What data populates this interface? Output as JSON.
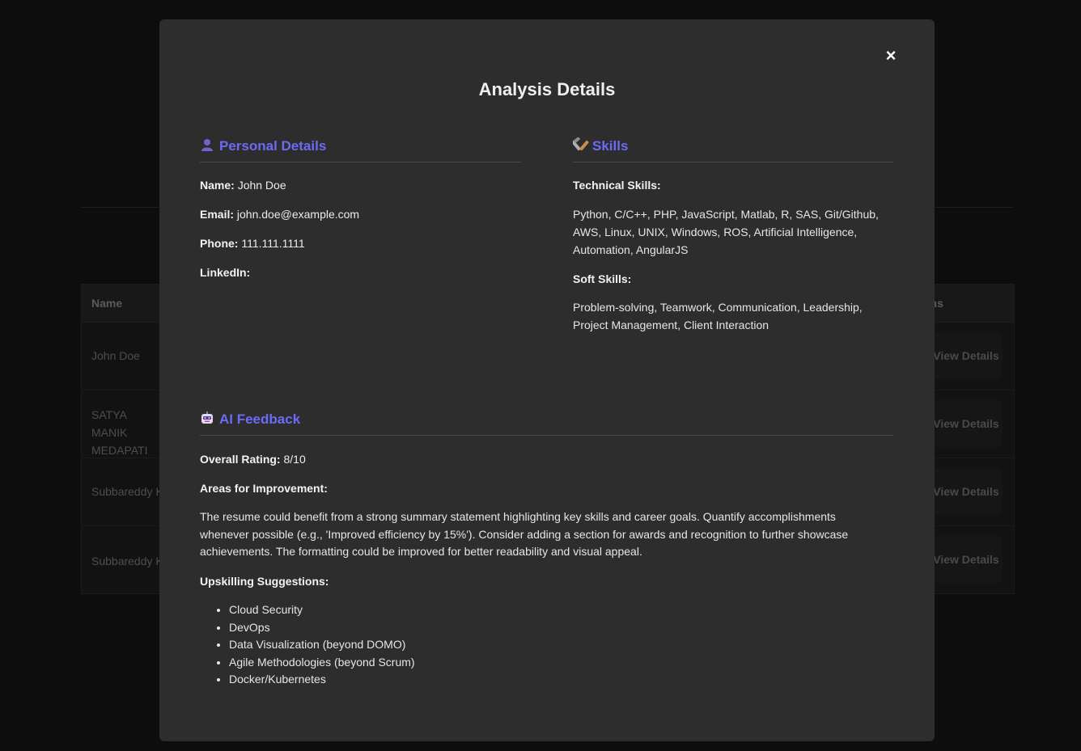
{
  "background": {
    "table_headers": {
      "name": "Name",
      "actions": "ons"
    },
    "rows": [
      {
        "name": "John Doe",
        "button": "View Details"
      },
      {
        "name": "SATYA MANIK MEDAPATI",
        "button": "View Details"
      },
      {
        "name": "Subbareddy K",
        "button": "View Details"
      },
      {
        "name": "Subbareddy K",
        "button": "View Details"
      }
    ]
  },
  "modal": {
    "title": "Analysis Details",
    "close_label": "×",
    "personal": {
      "heading": "Personal Details",
      "icon": "person-icon",
      "name_label": "Name:",
      "name_value": "John Doe",
      "email_label": "Email:",
      "email_value": "john.doe@example.com",
      "phone_label": "Phone:",
      "phone_value": "111.111.1111",
      "linkedin_label": "LinkedIn:"
    },
    "skills": {
      "heading": "Skills",
      "icon": "tools-icon",
      "technical_label": "Technical Skills:",
      "technical_value": "Python, C/C++, PHP, JavaScript, Matlab, R, SAS, Git/Github, AWS, Linux, UNIX, Windows, ROS, Artificial Intelligence, Automation, AngularJS",
      "soft_label": "Soft Skills:",
      "soft_value": "Problem-solving, Teamwork, Communication, Leadership, Project Management, Client Interaction"
    },
    "feedback": {
      "heading": "AI Feedback",
      "icon": "robot-icon",
      "rating_label": "Overall Rating:",
      "rating_value": "8/10",
      "improvement_label": "Areas for Improvement:",
      "improvement_text": "The resume could benefit from a strong summary statement highlighting key skills and career goals. Quantify accomplishments whenever possible (e.g., 'Improved efficiency by 15%'). Consider adding a section for awards and recognition to further showcase achievements. The formatting could be improved for better readability and visual appeal.",
      "upskilling_label": "Upskilling Suggestions:",
      "upskilling_items": [
        "Cloud Security",
        "DevOps",
        "Data Visualization (beyond DOMO)",
        "Agile Methodologies (beyond Scrum)",
        "Docker/Kubernetes"
      ]
    }
  },
  "colors": {
    "accent": "#6d6af5",
    "modal_bg": "#2d2d2d",
    "page_bg": "#0d0d0d"
  }
}
